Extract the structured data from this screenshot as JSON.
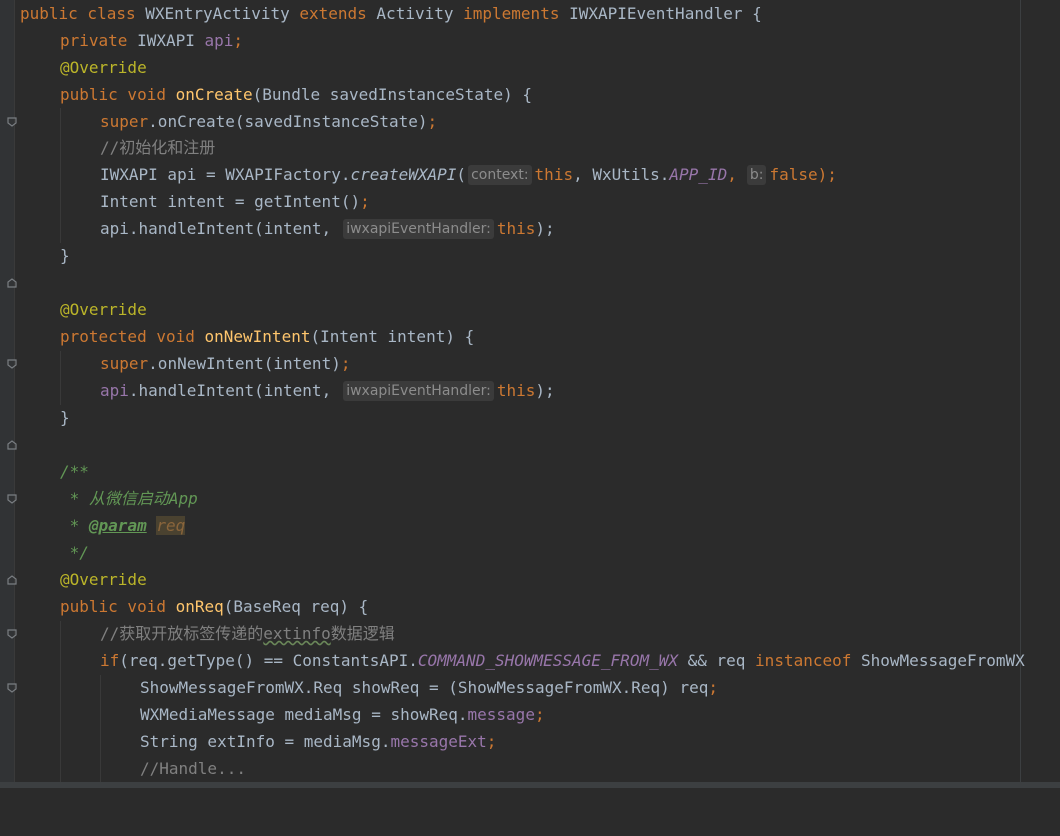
{
  "colors": {
    "background": "#2b2b2b",
    "keyword": "#cc7832",
    "annotation": "#bbb529",
    "method": "#ffc66d",
    "field": "#9876aa",
    "comment": "#808080",
    "doc": "#629755",
    "default": "#a9b7c6"
  },
  "code": {
    "l1": {
      "kw1": "public class ",
      "name": "WXEntryActivity ",
      "kw2": "extends ",
      "base": "Activity ",
      "kw3": "implements ",
      "iface": "IWXAPIEventHandler {"
    },
    "l2": {
      "kw": "private ",
      "type": "IWXAPI ",
      "field": "api",
      "semi": ";"
    },
    "l3": {
      "ann": "@Override"
    },
    "l4": {
      "kw": "public void ",
      "mth": "onCreate",
      "rest": "(Bundle savedInstanceState) {"
    },
    "l5": {
      "kw": "super",
      "rest": ".onCreate(savedInstanceState)",
      "semi": ";"
    },
    "l6": {
      "cmt": "//初始化和注册"
    },
    "l7": {
      "pre": "IWXAPI api = WXAPIFactory.",
      "mth": "createWXAPI",
      "open": "(",
      "hint1": "context:",
      "kw1": "this",
      "comma1": ", WxUtils.",
      "const": "APP_ID",
      "comma2": ",",
      "hint2": "b:",
      "kw2": "false",
      "close": ");"
    },
    "l8": {
      "pre": "Intent intent = getIntent()",
      "semi": ";"
    },
    "l9": {
      "pre": "api.handleIntent(intent,",
      "hint": "iwxapiEventHandler:",
      "kw": "this",
      "close": ");"
    },
    "l10": {
      "text": "}"
    },
    "l11": {
      "ann": "@Override"
    },
    "l12": {
      "kw": "protected void ",
      "mth": "onNewIntent",
      "rest": "(Intent intent) {"
    },
    "l13": {
      "kw": "super",
      "rest": ".onNewIntent(intent)",
      "semi": ";"
    },
    "l14": {
      "field": "api",
      "pre": ".handleIntent(intent,",
      "hint": "iwxapiEventHandler:",
      "kw": "this",
      "close": ");"
    },
    "l15": {
      "text": "}"
    },
    "l16": {
      "doc": "/**"
    },
    "l17": {
      "doc": " * 从微信启动App"
    },
    "l18": {
      "star": " * ",
      "tag": "@param",
      "ref": "req"
    },
    "l19": {
      "doc": " */"
    },
    "l20": {
      "ann": "@Override"
    },
    "l21": {
      "kw": "public void ",
      "mth": "onReq",
      "rest": "(BaseReq req) {"
    },
    "l22": {
      "cmt1": "//获取开放标签传递的",
      "cmt2": "extinfo",
      "cmt3": "数据逻辑"
    },
    "l23": {
      "kw": "if",
      "pre": "(req.getType() == ConstantsAPI.",
      "const": "COMMAND_SHOWMESSAGE_FROM_WX",
      "mid": " && req ",
      "kw2": "instanceof ",
      "post": "ShowMessageFromWX"
    },
    "l24": {
      "pre": "ShowMessageFromWX.Req showReq = (ShowMessageFromWX.Req) req",
      "semi": ";"
    },
    "l25": {
      "pre": "WXMediaMessage mediaMsg = showReq.",
      "field": "message",
      "semi": ";"
    },
    "l26": {
      "pre": "String extInfo = mediaMsg.",
      "field": "messageExt",
      "semi": ";"
    },
    "l27": {
      "cmt": "//Handle..."
    }
  }
}
